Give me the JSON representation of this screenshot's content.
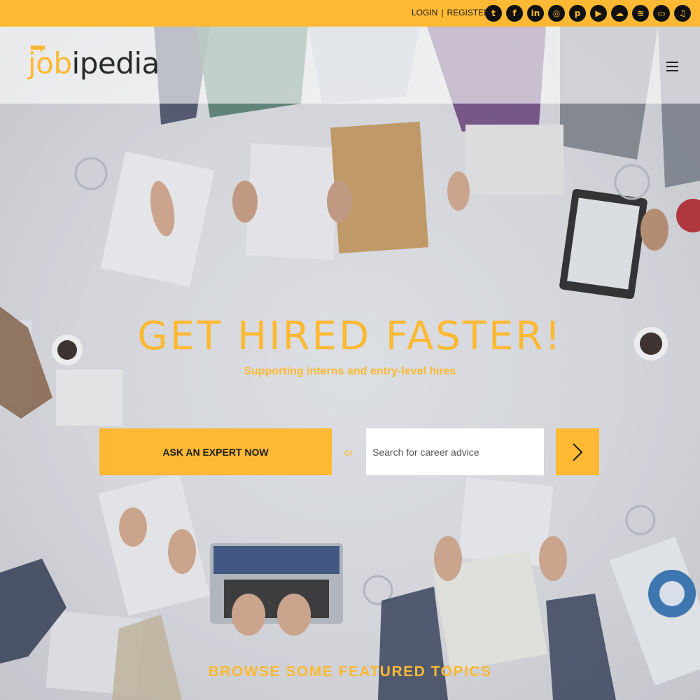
{
  "topbar": {
    "login_label": "LOGIN",
    "separator": "|",
    "register_label": "REGISTER",
    "social_icons": [
      "twitter-icon",
      "facebook-icon",
      "linkedin-icon",
      "instagram-icon",
      "pinterest-icon",
      "youtube-icon",
      "soundcloud-icon",
      "spotify-icon",
      "stitcher-icon",
      "music-icon"
    ],
    "social_glyphs": [
      "t",
      "f",
      "in",
      "◎",
      "p",
      "▶",
      "☁",
      "≋",
      "▭",
      "♫"
    ]
  },
  "header": {
    "logo_part1": "job",
    "logo_part2": "ipedia"
  },
  "hero": {
    "title": "GET HIRED FASTER!",
    "subtitle": "Supporting interns and entry-level hires",
    "ask_button_label": "ASK AN EXPERT NOW",
    "or_text": "or",
    "search_placeholder": "Search for career advice"
  },
  "featured": {
    "heading": "BROWSE SOME FEATURED TOPICS"
  },
  "colors": {
    "accent": "#fdb933",
    "dark": "#111111"
  }
}
